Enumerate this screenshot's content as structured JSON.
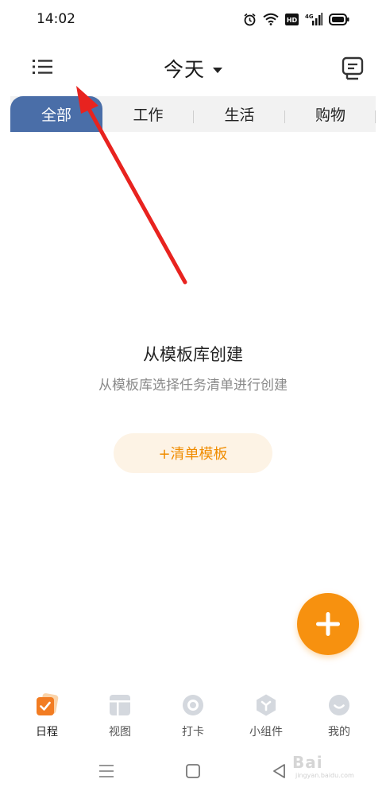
{
  "status_bar": {
    "time": "14:02",
    "icons": [
      "alarm-icon",
      "wifi-icon",
      "hd-icon",
      "signal-icon",
      "battery-icon"
    ],
    "hd_label": "HD",
    "network_label": "4G"
  },
  "header": {
    "menu_icon": "list-menu-icon",
    "title": "今天",
    "message_icon": "message-icon"
  },
  "tabs": [
    {
      "label": "全部",
      "active": true
    },
    {
      "label": "工作",
      "active": false
    },
    {
      "label": "生活",
      "active": false
    },
    {
      "label": "购物",
      "active": false
    }
  ],
  "empty_state": {
    "title": "从模板库创建",
    "description": "从模板库选择任务清单进行创建",
    "button_label": "+清单模板"
  },
  "bottom_nav": {
    "items": [
      {
        "label": "日程",
        "icon": "calendar-check-icon",
        "active": true
      },
      {
        "label": "视图",
        "icon": "view-layout-icon",
        "active": false
      },
      {
        "label": "打卡",
        "icon": "checkin-ring-icon",
        "active": false
      },
      {
        "label": "小组件",
        "icon": "widget-icon",
        "active": false
      },
      {
        "label": "我的",
        "icon": "profile-smile-icon",
        "active": false
      }
    ]
  },
  "watermark": {
    "brand": "Bai",
    "site": "jingyan.baidu.com"
  },
  "colors": {
    "tab_active": "#4a6ea8",
    "accent": "#f7910f",
    "template_button_bg": "#fdf3e5",
    "template_button_text": "#f08c00",
    "annotation_arrow": "#e8231f"
  }
}
